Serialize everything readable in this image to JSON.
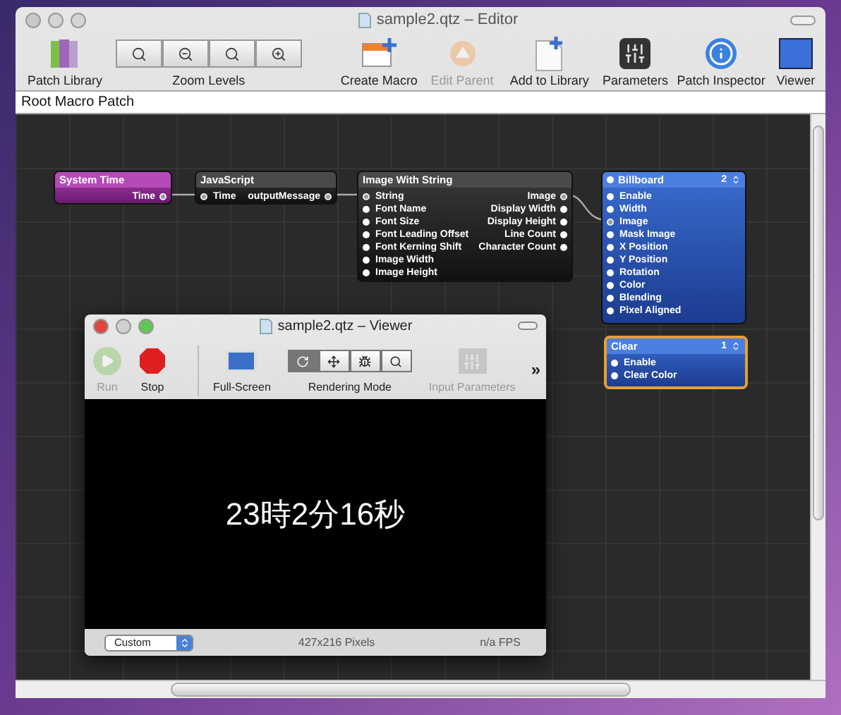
{
  "editor": {
    "title": "sample2.qtz – Editor",
    "toolbar": [
      {
        "kind": "library",
        "label": "Patch Library",
        "disabled": false
      },
      {
        "kind": "zoom",
        "label": "Zoom Levels",
        "disabled": false
      },
      {
        "kind": "macro",
        "label": "Create Macro",
        "disabled": false
      },
      {
        "kind": "parent",
        "label": "Edit Parent",
        "disabled": true
      },
      {
        "kind": "add",
        "label": "Add to Library",
        "disabled": false
      },
      {
        "kind": "parameters",
        "label": "Parameters",
        "disabled": false
      },
      {
        "kind": "inspector",
        "label": "Patch Inspector",
        "disabled": false
      },
      {
        "kind": "viewer",
        "label": "Viewer",
        "disabled": false
      }
    ],
    "path": "Root Macro Patch"
  },
  "nodes": [
    {
      "title": "System Time",
      "kind": "provider",
      "selected": false,
      "outputs": [
        {
          "label": "Time",
          "connected": true
        }
      ]
    },
    {
      "title": "JavaScript",
      "kind": "processor",
      "selected": false,
      "inputs": [
        {
          "label": "Time",
          "connected": true
        }
      ],
      "outputs": [
        {
          "label": "outputMessage",
          "connected": true
        }
      ]
    },
    {
      "title": "Image With String",
      "kind": "processor",
      "selected": false,
      "inputs": [
        {
          "label": "String",
          "connected": true
        },
        {
          "label": "Font Name",
          "connected": false
        },
        {
          "label": "Font Size",
          "connected": false
        },
        {
          "label": "Font Leading Offset",
          "connected": false
        },
        {
          "label": "Font Kerning Shift",
          "connected": false
        },
        {
          "label": "Image Width",
          "connected": false
        },
        {
          "label": "Image Height",
          "connected": false
        }
      ],
      "outputs": [
        {
          "label": "Image",
          "connected": true
        },
        {
          "label": "Display Width",
          "connected": false
        },
        {
          "label": "Display Height",
          "connected": false
        },
        {
          "label": "Line Count",
          "connected": false
        },
        {
          "label": "Character Count",
          "connected": false
        }
      ]
    },
    {
      "title": "Billboard",
      "kind": "consumer",
      "selected": false,
      "title_port": true,
      "badge": "2",
      "inputs": [
        {
          "label": "Enable",
          "connected": false
        },
        {
          "label": "Width",
          "connected": false
        },
        {
          "label": "Image",
          "connected": true
        },
        {
          "label": "Mask Image",
          "connected": false
        },
        {
          "label": "X Position",
          "connected": false
        },
        {
          "label": "Y Position",
          "connected": false
        },
        {
          "label": "Rotation",
          "connected": false
        },
        {
          "label": "Color",
          "connected": false
        },
        {
          "label": "Blending",
          "connected": false
        },
        {
          "label": "Pixel Aligned",
          "connected": false
        }
      ]
    },
    {
      "title": "Clear",
      "kind": "consumer",
      "selected": true,
      "badge": "1",
      "inputs": [
        {
          "label": "Enable",
          "connected": false
        },
        {
          "label": "Clear Color",
          "connected": false
        }
      ]
    }
  ],
  "viewer": {
    "title": "sample2.qtz – Viewer",
    "toolbar": [
      {
        "kind": "run",
        "label": "Run",
        "disabled": true
      },
      {
        "kind": "stop",
        "label": "Stop",
        "disabled": false
      },
      {
        "kind": "fullscreen",
        "label": "Full-Screen",
        "disabled": false
      },
      {
        "kind": "rendering",
        "label": "Rendering Mode",
        "disabled": false,
        "segments": [
          {
            "selected": true
          },
          {
            "selected": false
          },
          {
            "selected": false
          },
          {
            "selected": false
          }
        ]
      },
      {
        "kind": "parameters",
        "label": "Input Parameters",
        "disabled": true
      }
    ],
    "overflow": "»",
    "output_text": "23時2分16秒",
    "size_popup": "Custom",
    "pixels": "427x216 Pixels",
    "fps": "n/a FPS"
  }
}
